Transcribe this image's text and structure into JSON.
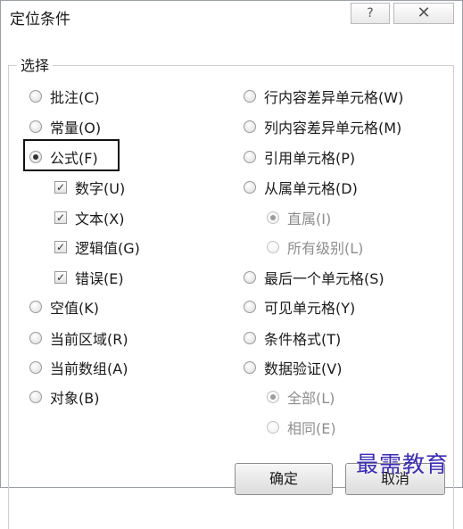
{
  "title": "定位条件",
  "titlebar": {
    "help_label": "?",
    "close_label": "✕"
  },
  "group_label": "选择",
  "left_options": [
    {
      "label": "批注(C)",
      "selected": false
    },
    {
      "label": "常量(O)",
      "selected": false
    },
    {
      "label": "公式(F)",
      "selected": true
    },
    {
      "label": "数字(U)",
      "checked": true
    },
    {
      "label": "文本(X)",
      "checked": true
    },
    {
      "label": "逻辑值(G)",
      "checked": true
    },
    {
      "label": "错误(E)",
      "checked": true
    },
    {
      "label": "空值(K)",
      "selected": false
    },
    {
      "label": "当前区域(R)",
      "selected": false
    },
    {
      "label": "当前数组(A)",
      "selected": false
    },
    {
      "label": "对象(B)",
      "selected": false
    }
  ],
  "right_options": [
    {
      "label": "行内容差异单元格(W)",
      "selected": false
    },
    {
      "label": "列内容差异单元格(M)",
      "selected": false
    },
    {
      "label": "引用单元格(P)",
      "selected": false
    },
    {
      "label": "从属单元格(D)",
      "selected": false
    },
    {
      "label": "直属(I)",
      "selected": true,
      "enabled": false
    },
    {
      "label": "所有级别(L)",
      "selected": false,
      "enabled": false
    },
    {
      "label": "最后一个单元格(S)",
      "selected": false
    },
    {
      "label": "可见单元格(Y)",
      "selected": false
    },
    {
      "label": "条件格式(T)",
      "selected": false
    },
    {
      "label": "数据验证(V)",
      "selected": false
    },
    {
      "label": "全部(L)",
      "selected": true,
      "enabled": false
    },
    {
      "label": "相同(E)",
      "selected": false,
      "enabled": false
    }
  ],
  "buttons": {
    "ok_label": "确定",
    "cancel_label": "取消"
  },
  "watermark": "最需教育",
  "colors": {
    "watermark": "#3b2db5",
    "focus_border": "#111111"
  }
}
